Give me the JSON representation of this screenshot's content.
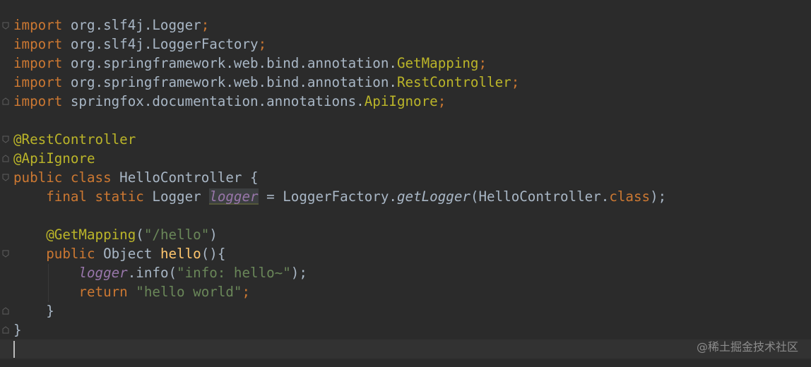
{
  "editor": {
    "language": "java",
    "colors": {
      "background": "#2b2b2b",
      "keyword": "#cc7832",
      "plain": "#a9b7c6",
      "annotation": "#bbb529",
      "string": "#6a8759",
      "static_field": "#9876aa",
      "method_declaration": "#ffc66d",
      "current_line": "#323232"
    },
    "icons": {
      "fold": "fold-marker-icon",
      "caret": "text-caret-icon"
    },
    "lines": [
      {
        "tokens": [
          {
            "t": "import",
            "c": "kw"
          },
          {
            "t": " org.slf4j.Logger",
            "c": "plain"
          },
          {
            "t": ";",
            "c": "punct"
          }
        ]
      },
      {
        "tokens": [
          {
            "t": "import",
            "c": "kw"
          },
          {
            "t": " org.slf4j.LoggerFactory",
            "c": "plain"
          },
          {
            "t": ";",
            "c": "punct"
          }
        ]
      },
      {
        "tokens": [
          {
            "t": "import",
            "c": "kw"
          },
          {
            "t": " org.springframework.web.bind.annotation.",
            "c": "plain"
          },
          {
            "t": "GetMapping",
            "c": "ann"
          },
          {
            "t": ";",
            "c": "punct"
          }
        ]
      },
      {
        "tokens": [
          {
            "t": "import",
            "c": "kw"
          },
          {
            "t": " org.springframework.web.bind.annotation.",
            "c": "plain"
          },
          {
            "t": "RestController",
            "c": "ann"
          },
          {
            "t": ";",
            "c": "punct"
          }
        ]
      },
      {
        "tokens": [
          {
            "t": "import",
            "c": "kw"
          },
          {
            "t": " springfox.documentation.annotations.",
            "c": "plain"
          },
          {
            "t": "ApiIgnore",
            "c": "ann"
          },
          {
            "t": ";",
            "c": "punct"
          }
        ]
      },
      {
        "tokens": []
      },
      {
        "tokens": [
          {
            "t": "@RestController",
            "c": "ann"
          }
        ]
      },
      {
        "tokens": [
          {
            "t": "@ApiIgnore",
            "c": "ann"
          }
        ]
      },
      {
        "tokens": [
          {
            "t": "public class",
            "c": "kw"
          },
          {
            "t": " HelloController {",
            "c": "plain"
          }
        ]
      },
      {
        "tokens": [
          {
            "t": "    ",
            "c": "plain"
          },
          {
            "t": "final static",
            "c": "kw"
          },
          {
            "t": " Logger ",
            "c": "plain"
          },
          {
            "t": "logger",
            "c": "italic-field",
            "hl": true
          },
          {
            "t": " = LoggerFactory.",
            "c": "plain"
          },
          {
            "t": "getLogger",
            "c": "italic-method"
          },
          {
            "t": "(HelloController.",
            "c": "plain"
          },
          {
            "t": "class",
            "c": "kw"
          },
          {
            "t": ");",
            "c": "plain"
          }
        ]
      },
      {
        "tokens": []
      },
      {
        "tokens": [
          {
            "t": "    ",
            "c": "plain"
          },
          {
            "t": "@GetMapping",
            "c": "ann"
          },
          {
            "t": "(",
            "c": "plain"
          },
          {
            "t": "\"/hello\"",
            "c": "str"
          },
          {
            "t": ")",
            "c": "plain"
          }
        ]
      },
      {
        "tokens": [
          {
            "t": "    ",
            "c": "plain"
          },
          {
            "t": "public",
            "c": "kw"
          },
          {
            "t": " Object ",
            "c": "plain"
          },
          {
            "t": "hello",
            "c": "method"
          },
          {
            "t": "(){",
            "c": "plain"
          }
        ]
      },
      {
        "tokens": [
          {
            "t": "        ",
            "c": "plain"
          },
          {
            "t": "logger",
            "c": "italic-field"
          },
          {
            "t": ".info(",
            "c": "plain"
          },
          {
            "t": "\"info: hello~\"",
            "c": "str"
          },
          {
            "t": ");",
            "c": "plain"
          }
        ]
      },
      {
        "tokens": [
          {
            "t": "        ",
            "c": "plain"
          },
          {
            "t": "return",
            "c": "kw"
          },
          {
            "t": " ",
            "c": "plain"
          },
          {
            "t": "\"hello world\"",
            "c": "str"
          },
          {
            "t": ";",
            "c": "punct"
          }
        ]
      },
      {
        "tokens": [
          {
            "t": "    }",
            "c": "plain"
          }
        ]
      },
      {
        "tokens": [
          {
            "t": "}",
            "c": "plain"
          }
        ]
      },
      {
        "tokens": []
      }
    ]
  },
  "watermark": {
    "text": "@稀土掘金技术社区"
  }
}
